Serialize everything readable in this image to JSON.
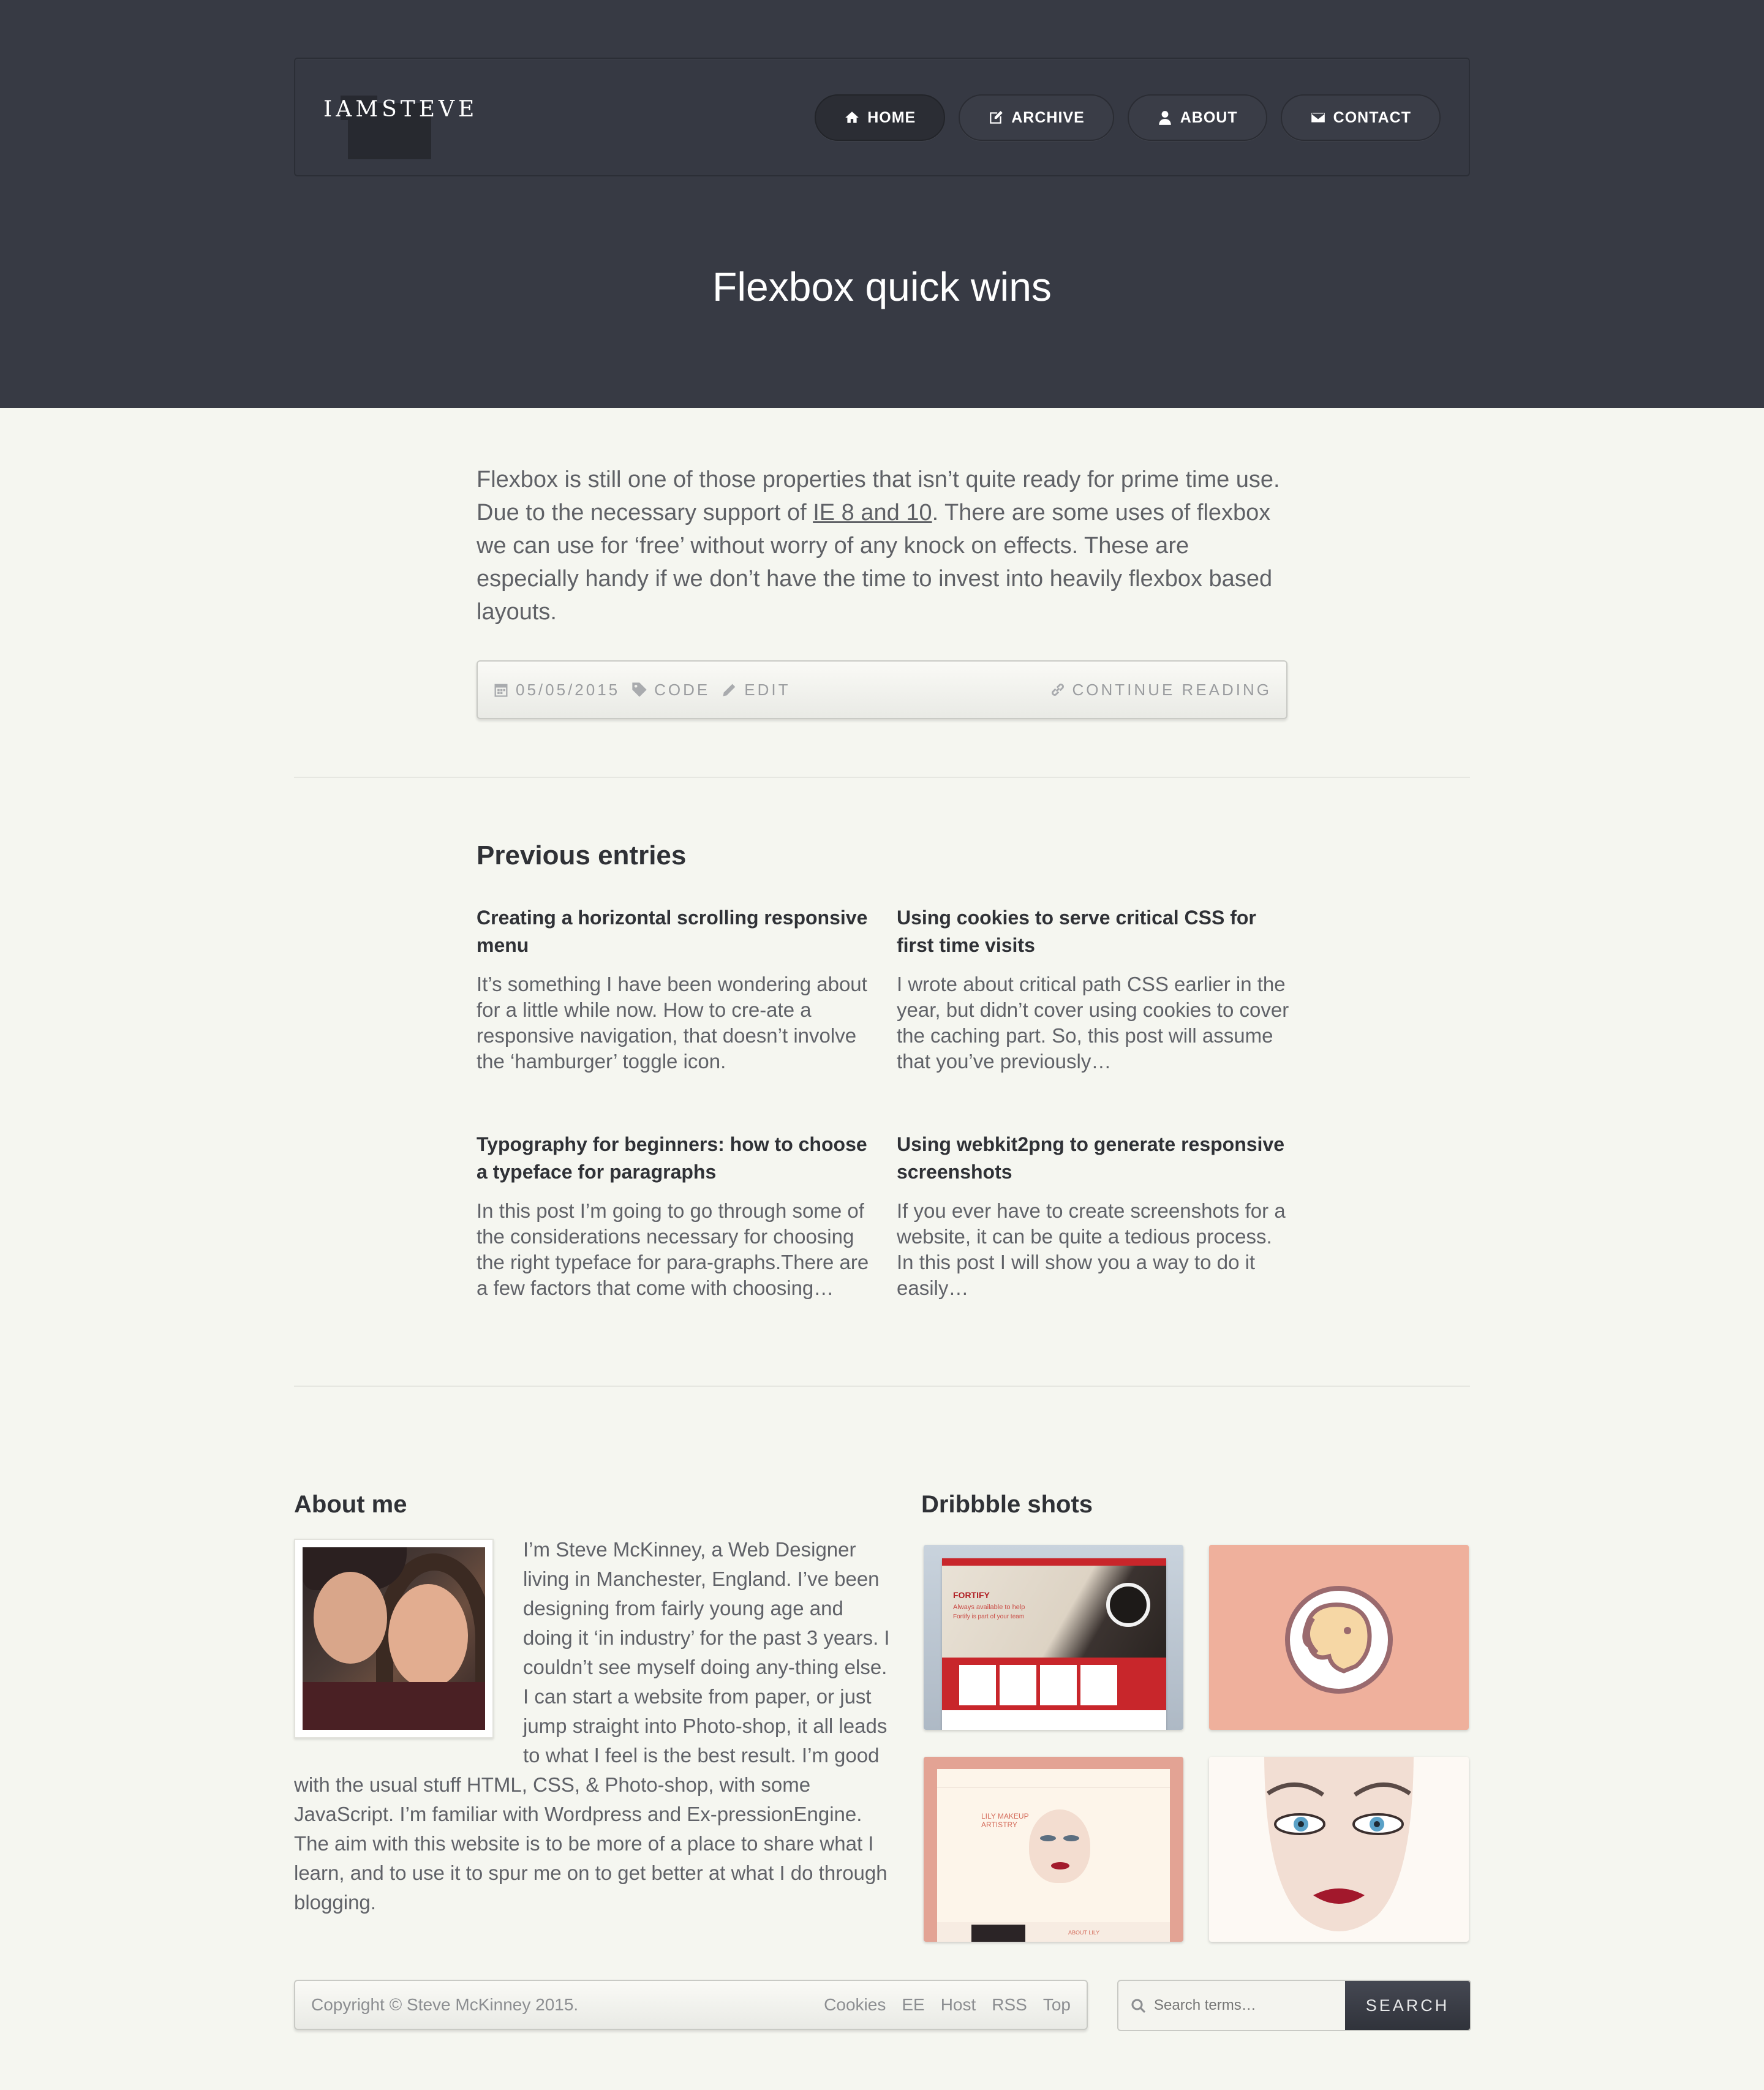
{
  "header": {
    "logo_text": "IAMSTEVE",
    "nav": [
      {
        "label": "HOME",
        "icon": "home-icon"
      },
      {
        "label": "ARCHIVE",
        "icon": "edit-icon"
      },
      {
        "label": "ABOUT",
        "icon": "user-icon"
      },
      {
        "label": "CONTACT",
        "icon": "mail-icon"
      }
    ],
    "page_title": "Flexbox quick wins"
  },
  "post": {
    "intro_before": "Flexbox is still one of those properties that isn’t quite ready for prime time use. Due to the necessary support of ",
    "intro_link": "IE 8 and 10",
    "intro_after": ". There are some uses of flexbox we can use for ‘free’ without worry of any knock on effects. These are especially handy if we don’t have the time to invest into heavily flexbox based layouts.",
    "date": "05/05/2015",
    "category": "CODE",
    "edit": "EDIT",
    "continue": "CONTINUE READING"
  },
  "previous": {
    "heading": "Previous entries",
    "entries": [
      {
        "title": "Creating a horizontal scrolling responsive menu",
        "excerpt": "It’s something I have been wondering about for a little while now. How to cre-ate a responsive navigation, that doesn’t involve the ‘hamburger’ toggle icon."
      },
      {
        "title": "Using cookies to serve critical CSS for first time visits",
        "excerpt": "I wrote about critical path CSS earlier in the year, but didn’t cover using cookies to cover the caching part. So, this post will assume that you’ve previously…"
      },
      {
        "title": "Typography for beginners: how to choose a typeface for paragraphs",
        "excerpt": "In this post I’m going to go through some of the considerations necessary for choosing the right typeface for para-graphs.There are a few factors that come with choosing…"
      },
      {
        "title": "Using webkit2png to generate responsive screenshots",
        "excerpt": "If you ever have to create screenshots for a website, it can be quite a tedious process. In this post I will show you a way to do it easily…"
      }
    ]
  },
  "about": {
    "heading": "About me",
    "text": "I’m Steve McKinney, a Web Designer living in Manchester, England. I’ve been designing from fairly young age and doing it ‘in industry’ for the past 3 years. I couldn’t see myself doing any-thing else. I can start a website from paper, or just jump straight into Photo-shop, it all leads to what I feel is the best result. I’m good with the usual stuff HTML, CSS, & Photo-shop, with some JavaScript. I’m familiar with Wordpress and Ex-pressionEngine. The aim with this website is to be more of a place to share what I learn, and to use it to spur me on to get better at what I do through blogging."
  },
  "dribbble": {
    "heading": "Dribbble shots",
    "shot1_brand": "FORTIFY",
    "shot1_tagline": "Always available to help",
    "shot1_sub": "Fortify is part of your team",
    "shot3_title": "LILY MAKEUP ARTISTRY",
    "shot3_footer": "ABOUT LILY"
  },
  "footer": {
    "copyright": "Copyright © Steve McKinney 2015.",
    "links": [
      "Cookies",
      "EE",
      "Host",
      "RSS",
      "Top"
    ],
    "search_placeholder": "Search terms…",
    "search_button": "SEARCH"
  }
}
